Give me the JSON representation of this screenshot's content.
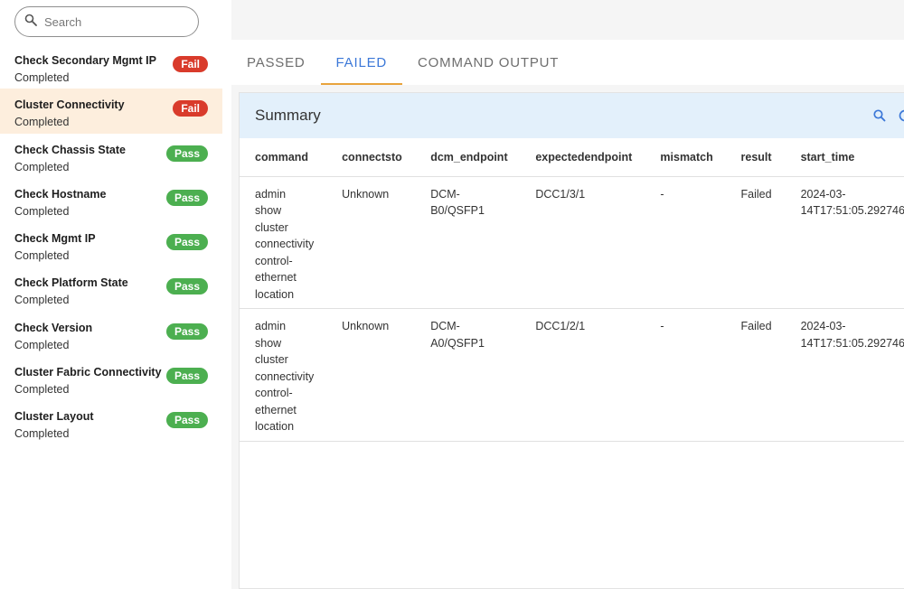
{
  "search": {
    "placeholder": "Search"
  },
  "checks": [
    {
      "name": "Check Secondary Mgmt IP",
      "status": "Completed",
      "result": "Fail"
    },
    {
      "name": "Cluster Connectivity",
      "status": "Completed",
      "result": "Fail",
      "selected": true
    },
    {
      "name": "Check Chassis State",
      "status": "Completed",
      "result": "Pass"
    },
    {
      "name": "Check Hostname",
      "status": "Completed",
      "result": "Pass"
    },
    {
      "name": "Check Mgmt IP",
      "status": "Completed",
      "result": "Pass"
    },
    {
      "name": "Check Platform State",
      "status": "Completed",
      "result": "Pass"
    },
    {
      "name": "Check Version",
      "status": "Completed",
      "result": "Pass"
    },
    {
      "name": "Cluster Fabric Connectivity",
      "status": "Completed",
      "result": "Pass"
    },
    {
      "name": "Cluster Layout",
      "status": "Completed",
      "result": "Pass"
    }
  ],
  "tabs": [
    {
      "label": "PASSED",
      "active": false
    },
    {
      "label": "FAILED",
      "active": true
    },
    {
      "label": "COMMAND OUTPUT",
      "active": false
    }
  ],
  "summary": {
    "title": "Summary",
    "icons": [
      "search-icon",
      "refresh-icon"
    ],
    "columns": [
      "command",
      "connectsto",
      "dcm_endpoint",
      "expectedendpoint",
      "mismatch",
      "result",
      "start_time"
    ],
    "rows": [
      {
        "command": [
          "admin",
          "show",
          "cluster",
          "connectivity",
          "control-",
          "ethernet",
          "location"
        ],
        "connectsto": "Unknown",
        "dcm_endpoint": [
          "DCM-",
          "B0/QSFP1"
        ],
        "expectedendpoint": "DCC1/3/1",
        "mismatch": "-",
        "result": "Failed",
        "start_time": [
          "2024-03-",
          "14T17:51:05.292746"
        ]
      },
      {
        "command": [
          "admin",
          "show",
          "cluster",
          "connectivity",
          "control-",
          "ethernet",
          "location"
        ],
        "connectsto": "Unknown",
        "dcm_endpoint": [
          "DCM-",
          "A0/QSFP1"
        ],
        "expectedendpoint": "DCC1/2/1",
        "mismatch": "-",
        "result": "Failed",
        "start_time": [
          "2024-03-",
          "14T17:51:05.292746"
        ]
      }
    ]
  },
  "colors": {
    "fail": "#d93b2b",
    "pass": "#4caf50",
    "accent": "#3c78d8",
    "tab_underline": "#e8a33c",
    "selected_bg": "#fdeedd",
    "header_bg": "#e3f0fb"
  }
}
